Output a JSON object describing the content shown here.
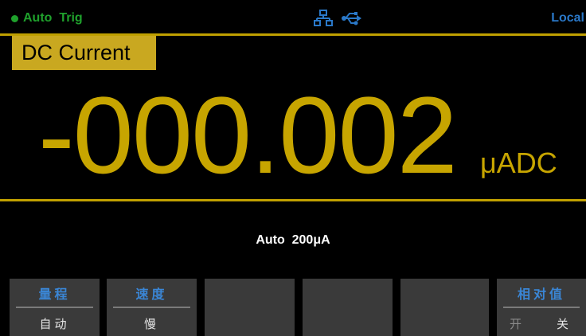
{
  "status": {
    "trigger_label": "Auto  Trig",
    "trigger_color": "#1fa12c",
    "icons": [
      "network-icon",
      "usb-icon"
    ],
    "remote_label": "Local",
    "remote_color": "#2a78c8"
  },
  "measurement": {
    "function": "DC Current",
    "reading": "-000.002",
    "unit": "μADC",
    "range": "Auto  200μA",
    "accent_color": "#c7a500"
  },
  "softkeys": [
    {
      "title": "量程",
      "value": "自动"
    },
    {
      "title": "速度",
      "value": "慢"
    },
    {
      "title": "",
      "value": ""
    },
    {
      "title": "",
      "value": ""
    },
    {
      "title": "",
      "value": ""
    },
    {
      "title": "相对值",
      "options": [
        "开",
        "关"
      ]
    }
  ]
}
